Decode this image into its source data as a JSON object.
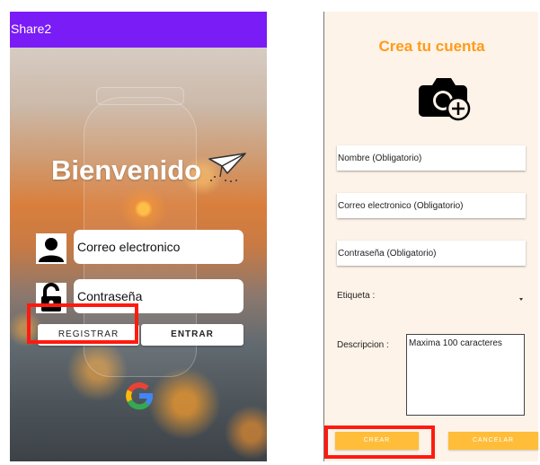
{
  "login_screen": {
    "app_title": "Share2",
    "welcome_text": "Bienvenido",
    "email_placeholder": "Correo electronico",
    "password_placeholder": "Contraseña",
    "register_button": "REGISTRAR",
    "enter_button": "ENTRAR"
  },
  "signup_screen": {
    "title": "Crea tu cuenta",
    "name_placeholder": "Nombre (Obligatorio)",
    "email_placeholder": "Correo electronico (Obligatorio)",
    "password_placeholder": "Contraseña (Obligatorio)",
    "tag_label": "Etiqueta :",
    "description_label": "Descripcion :",
    "description_placeholder": "Maxima 100 caracteres",
    "create_button": "CREAR",
    "cancel_button": "CANCELAR"
  },
  "colors": {
    "app_bar": "#7a1cf5",
    "accent_orange": "#ff9b1a",
    "button_orange": "#ffbd3a",
    "highlight_red": "#ff1a0f"
  }
}
